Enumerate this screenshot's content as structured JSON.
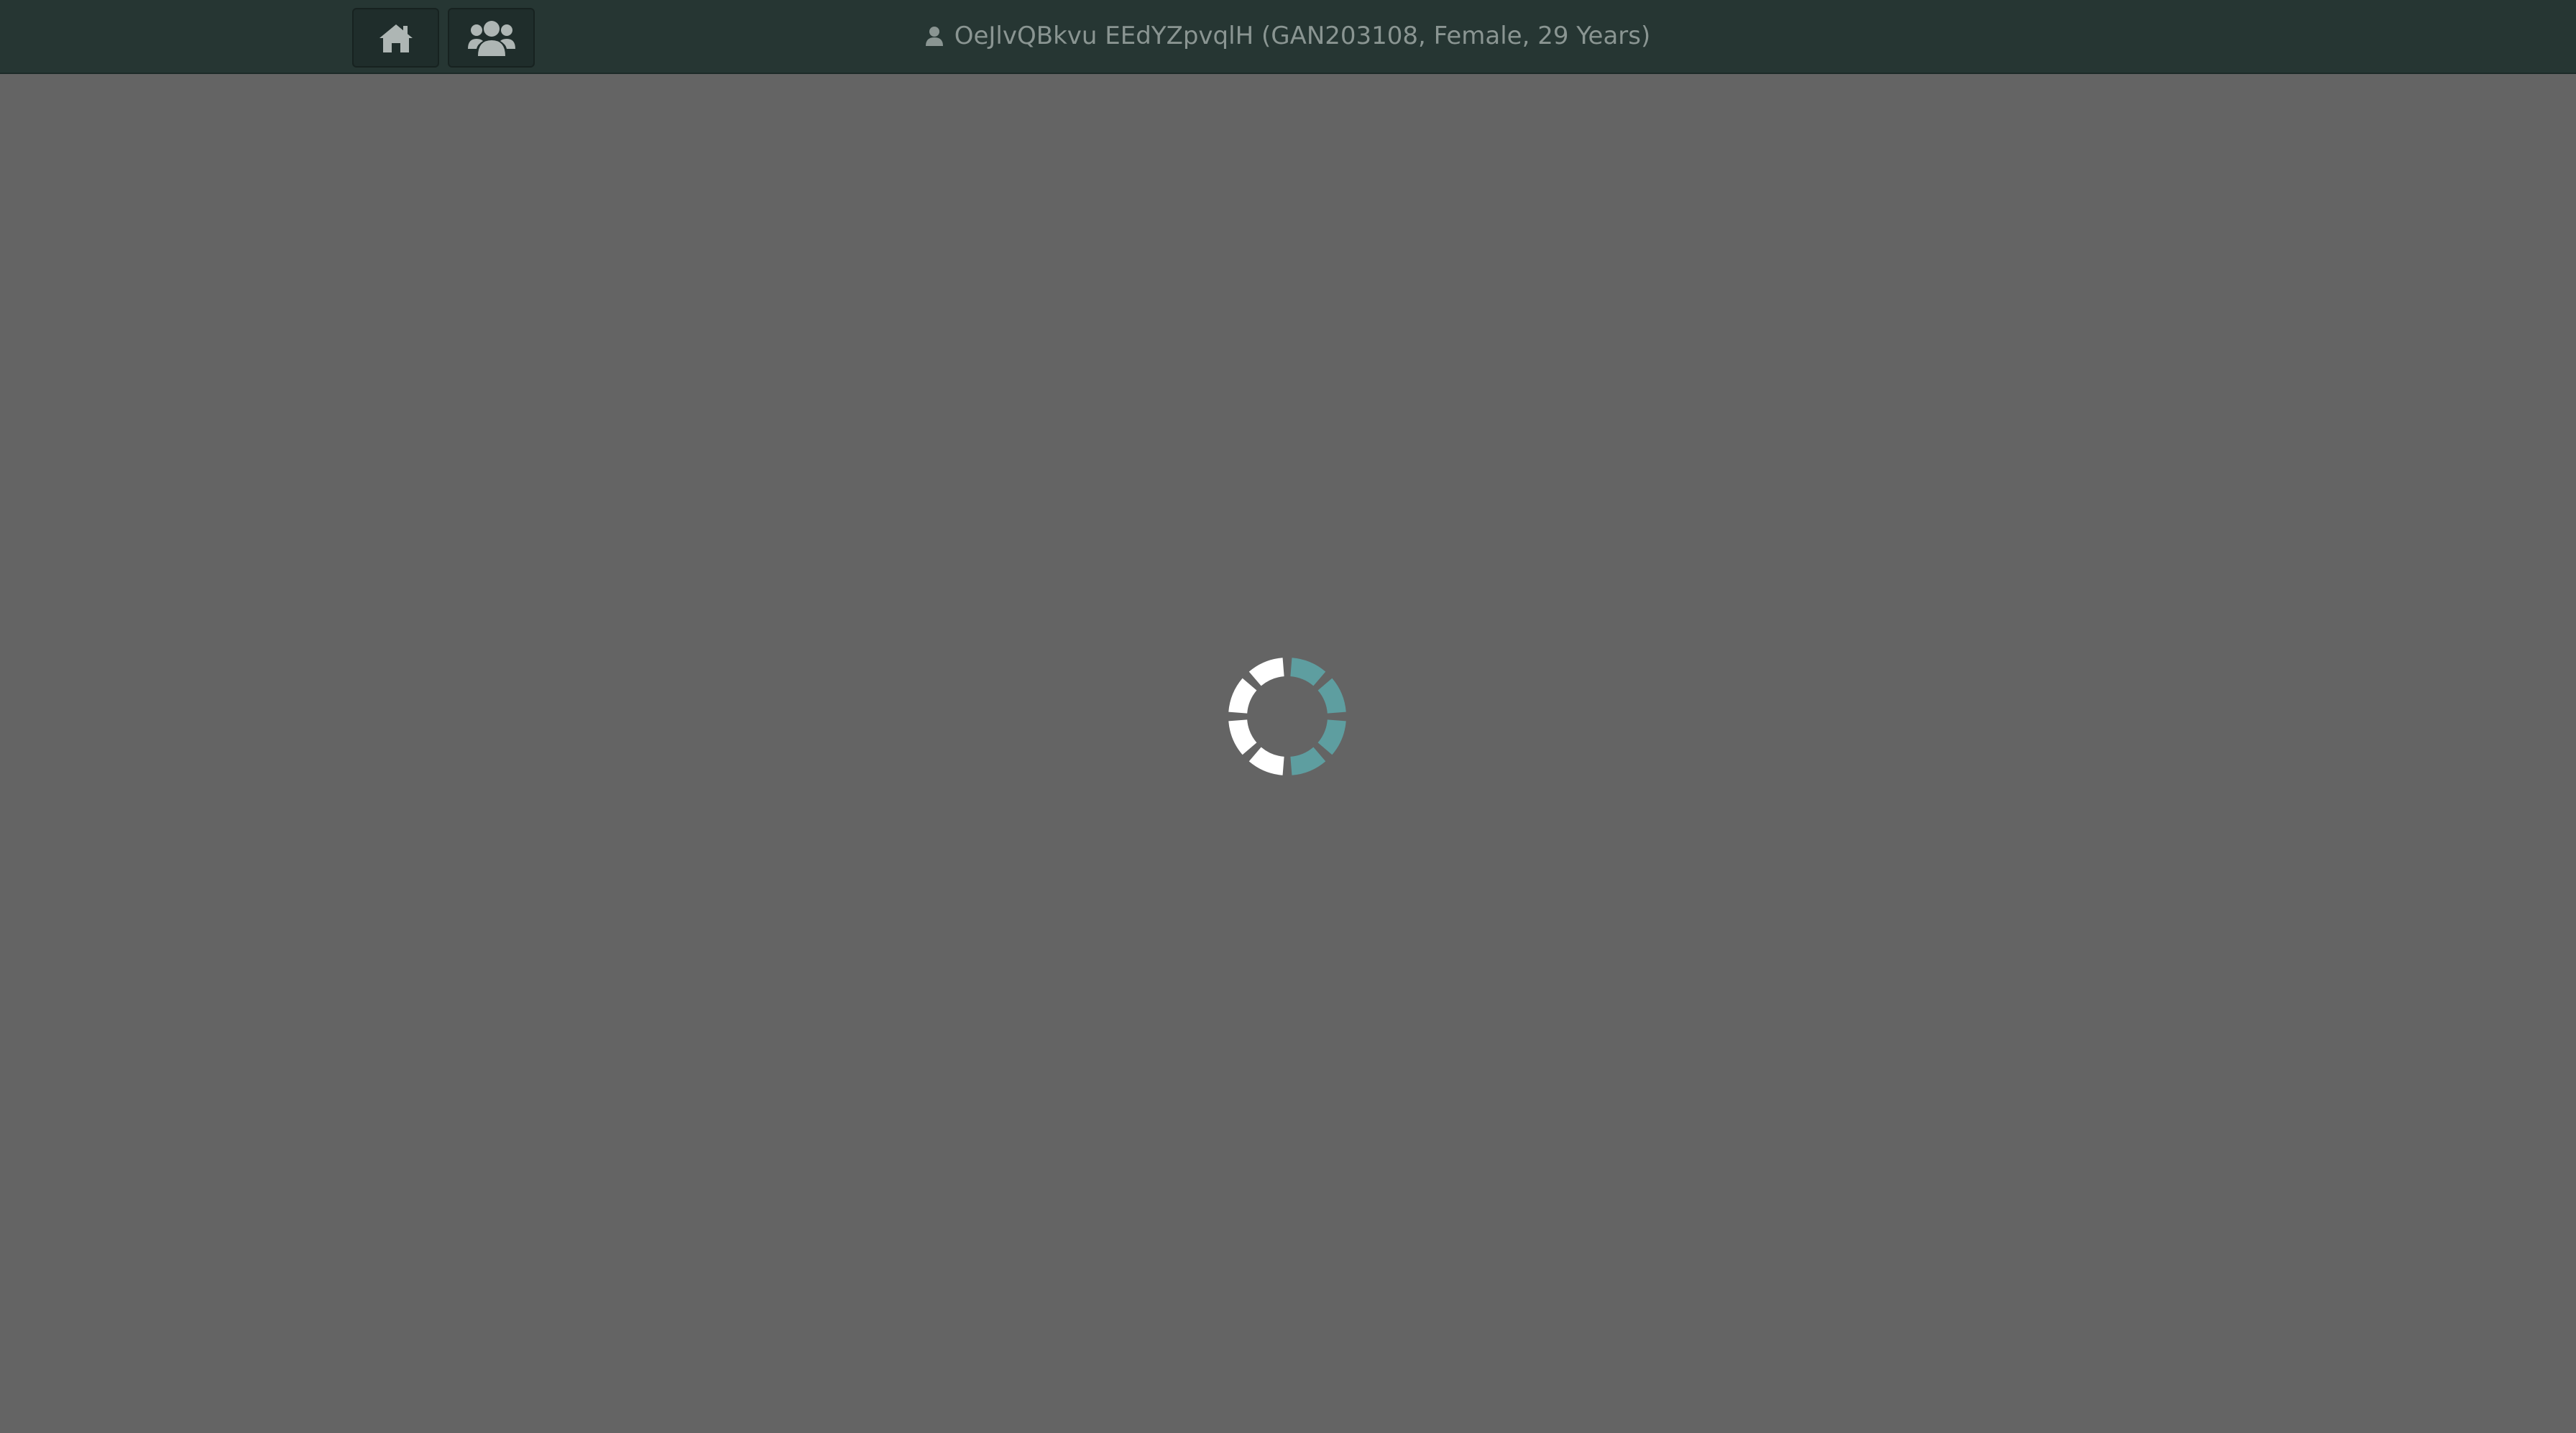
{
  "header": {
    "home_icon": "home-icon",
    "patients_icon": "users-icon",
    "patient_icon": "user-icon",
    "patient_label": "OeJlvQBkvu EEdYZpvqlH (GAN203108, Female, 29 Years)"
  },
  "loading": {
    "spinner_icon": "loading-spinner"
  },
  "colors": {
    "topbar": "#263633",
    "overlay": "#646464",
    "spinner_accent": "#5e9ea0",
    "spinner_base": "#ffffff"
  }
}
